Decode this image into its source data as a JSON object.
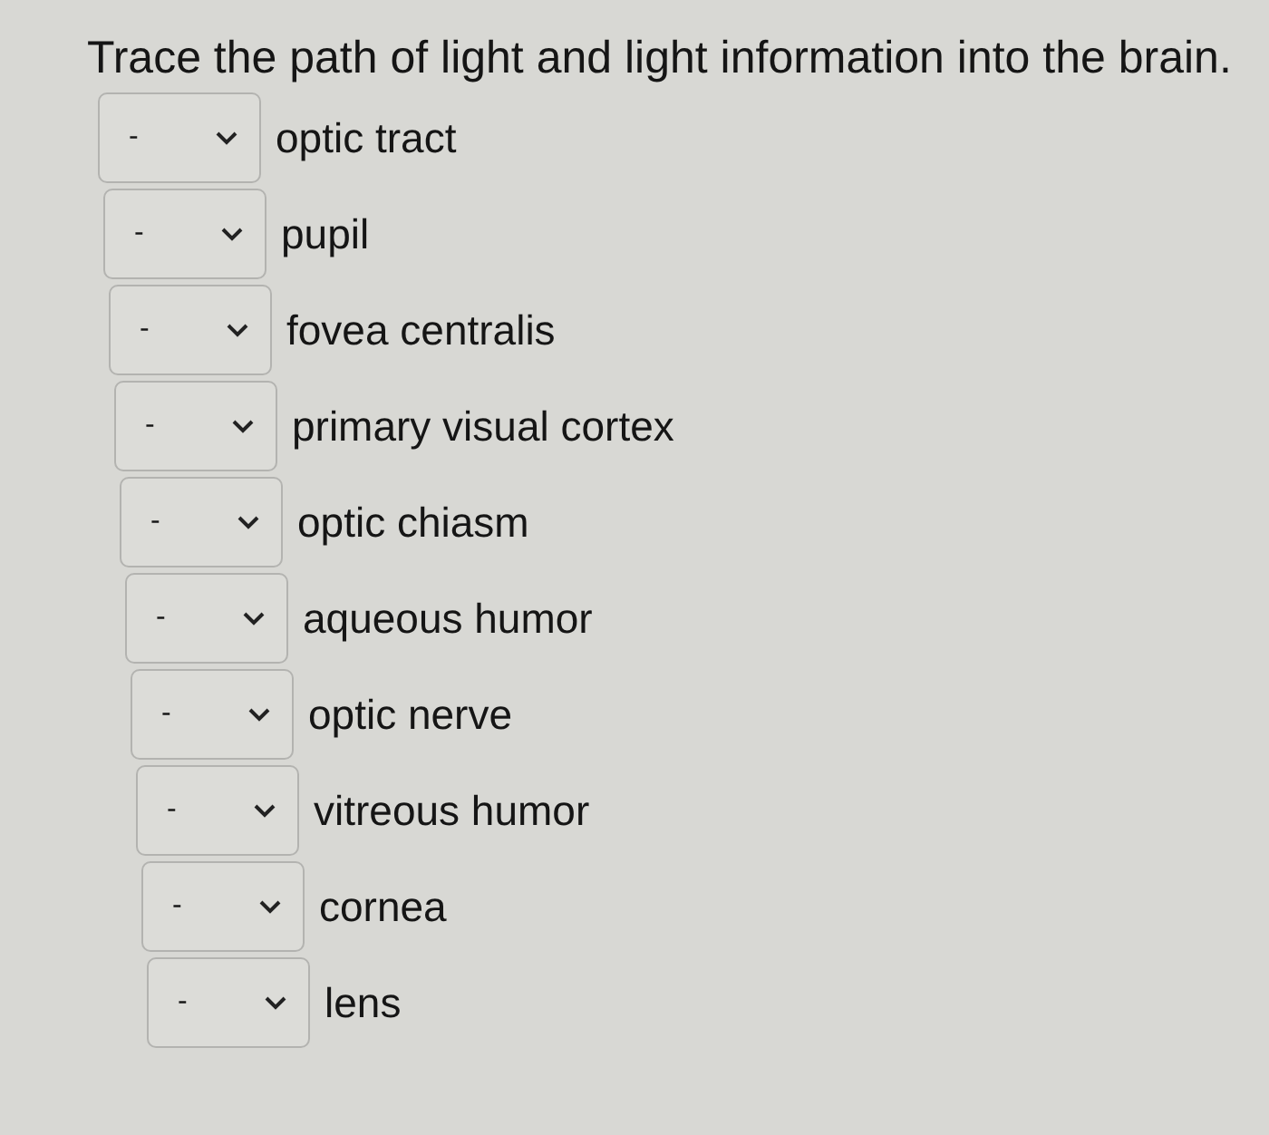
{
  "question": "Trace the path of light and light information into the brain.",
  "items": [
    {
      "value": "-",
      "label": "optic tract"
    },
    {
      "value": "-",
      "label": "pupil"
    },
    {
      "value": "-",
      "label": "fovea centralis"
    },
    {
      "value": "-",
      "label": "primary visual cortex"
    },
    {
      "value": "-",
      "label": "optic chiasm"
    },
    {
      "value": "-",
      "label": "aqueous humor"
    },
    {
      "value": "-",
      "label": "optic nerve"
    },
    {
      "value": "-",
      "label": "vitreous humor"
    },
    {
      "value": "-",
      "label": "cornea"
    },
    {
      "value": "-",
      "label": "lens"
    }
  ]
}
